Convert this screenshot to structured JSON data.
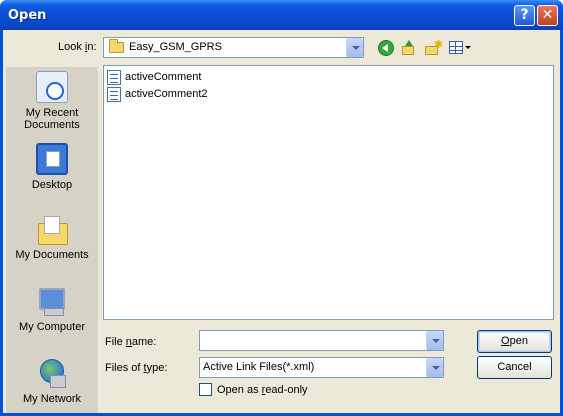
{
  "window": {
    "title": "Open",
    "help_glyph": "?",
    "close_glyph": "✕"
  },
  "lookin": {
    "label_prefix": "Look ",
    "label_key": "i",
    "label_suffix": "n:",
    "value": "Easy_GSM_GPRS"
  },
  "toolbar": {
    "icons": [
      "back-icon",
      "up-folder-icon",
      "new-folder-icon",
      "views-menu-icon"
    ]
  },
  "places": [
    {
      "label_line1": "My Recent",
      "label_line2": "Documents",
      "icon": "recent-documents-icon"
    },
    {
      "label_line1": "Desktop",
      "label_line2": "",
      "icon": "desktop-icon"
    },
    {
      "label_line1": "My Documents",
      "label_line2": "",
      "icon": "my-documents-icon"
    },
    {
      "label_line1": "My Computer",
      "label_line2": "",
      "icon": "my-computer-icon"
    },
    {
      "label_line1": "My Network",
      "label_line2": "",
      "icon": "my-network-icon"
    }
  ],
  "files": [
    {
      "name": "activeComment",
      "icon": "xml-file-icon"
    },
    {
      "name": "activeComment2",
      "icon": "xml-file-icon"
    }
  ],
  "filename": {
    "label_prefix": "File ",
    "label_key": "n",
    "label_suffix": "ame:",
    "value": ""
  },
  "filetype": {
    "label_prefix": "Files of ",
    "label_key": "t",
    "label_suffix": "ype:",
    "value": "Active Link Files(*.xml)"
  },
  "readonly": {
    "label_prefix": "Open as ",
    "label_key": "r",
    "label_suffix": "ead-only",
    "checked": false
  },
  "buttons": {
    "open_key": "O",
    "open_rest": "pen",
    "cancel": "Cancel"
  },
  "colors": {
    "titlebar": "#0a4fd8",
    "dialog_bg": "#ece9d8",
    "places_bg": "#d6d3c6",
    "field_border": "#7f9db9"
  }
}
